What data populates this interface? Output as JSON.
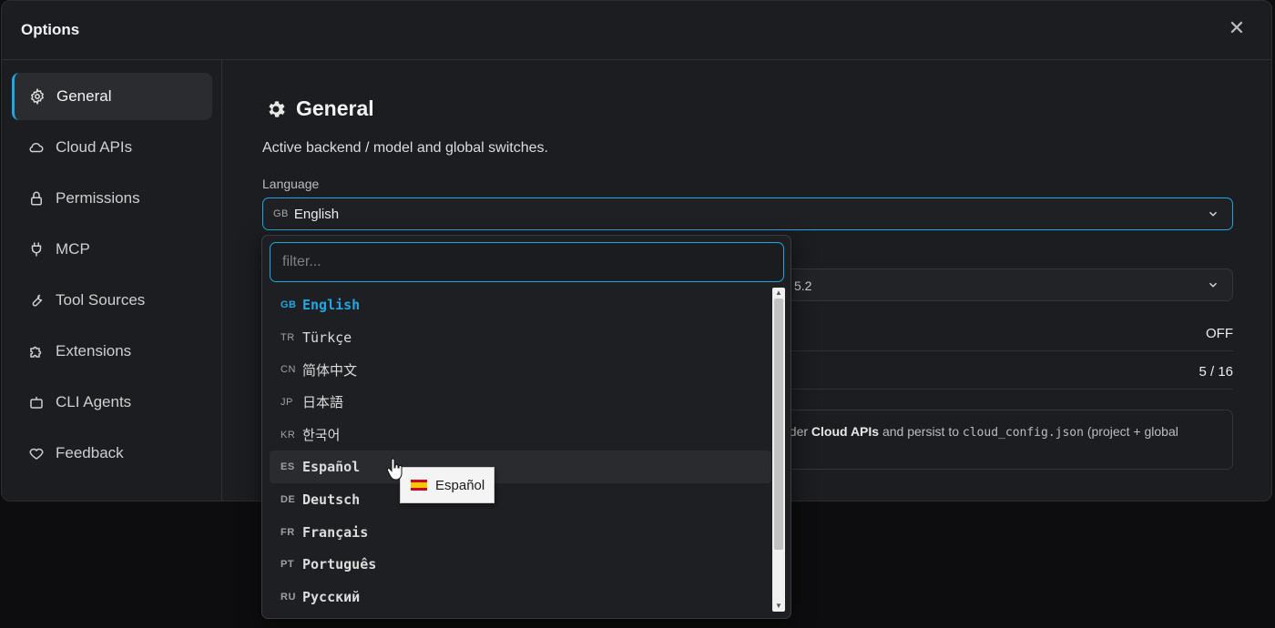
{
  "dialog": {
    "title": "Options"
  },
  "sidebar": {
    "items": [
      {
        "label": "General",
        "icon": "gear-icon",
        "active": true
      },
      {
        "label": "Cloud APIs",
        "icon": "cloud-icon"
      },
      {
        "label": "Permissions",
        "icon": "lock-icon"
      },
      {
        "label": "MCP",
        "icon": "plug-icon"
      },
      {
        "label": "Tool Sources",
        "icon": "wrench-icon"
      },
      {
        "label": "Extensions",
        "icon": "puzzle-icon"
      },
      {
        "label": "CLI Agents",
        "icon": "bot-icon"
      },
      {
        "label": "Feedback",
        "icon": "heart-icon"
      }
    ]
  },
  "main": {
    "title": "General",
    "subtitle": "Active backend / model and global switches.",
    "language_label": "Language",
    "language_select": {
      "code": "GB",
      "value": "English"
    },
    "model_select_value_fragment": "5.2",
    "row1_value": "OFF",
    "row2_value": "5 / 16",
    "info_prefix": "nder ",
    "info_bold": "Cloud APIs",
    "info_mid": " and persist to ",
    "info_mono": "cloud_config.json",
    "info_suffix": " (project + global"
  },
  "dropdown": {
    "filter_placeholder": "filter...",
    "options": [
      {
        "code": "GB",
        "label": "English"
      },
      {
        "code": "TR",
        "label": "Türkçe"
      },
      {
        "code": "CN",
        "label": "简体中文"
      },
      {
        "code": "JP",
        "label": "日本語"
      },
      {
        "code": "KR",
        "label": "한국어"
      },
      {
        "code": "ES",
        "label": "Español"
      },
      {
        "code": "DE",
        "label": "Deutsch"
      },
      {
        "code": "FR",
        "label": "Français"
      },
      {
        "code": "PT",
        "label": "Português"
      },
      {
        "code": "RU",
        "label": "Русский"
      }
    ],
    "tooltip": "Español"
  },
  "colors": {
    "accent": "#1ea7e1",
    "background": "#1c1d20"
  }
}
